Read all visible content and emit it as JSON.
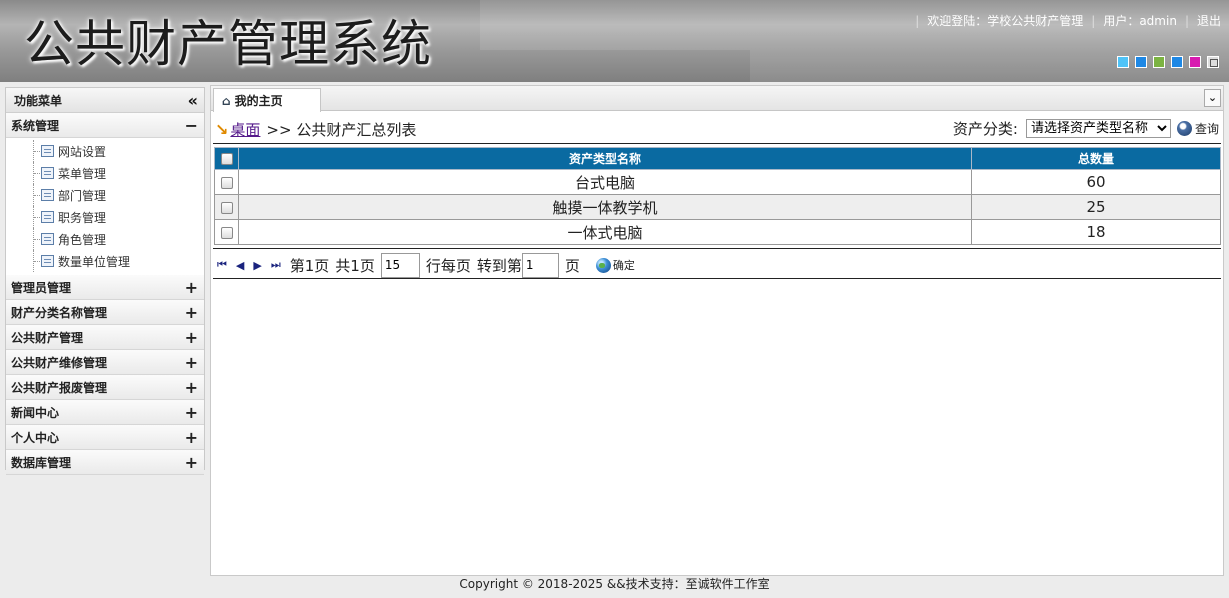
{
  "header": {
    "title": "公共财产管理系统",
    "welcome": "欢迎登陆：学校公共财产管理",
    "user_label": "用户：admin",
    "logout": "退出",
    "skin_colors": [
      "#4fc3f7",
      "#1e88e5",
      "#7cb342",
      "#1e88e5",
      "#d81bb0"
    ]
  },
  "sidebar": {
    "title": "功能菜单",
    "groups": [
      {
        "label": "系统管理",
        "expanded": true,
        "items": [
          "网站设置",
          "菜单管理",
          "部门管理",
          "职务管理",
          "角色管理",
          "数量单位管理"
        ]
      },
      {
        "label": "管理员管理"
      },
      {
        "label": "财产分类名称管理"
      },
      {
        "label": "公共财产管理"
      },
      {
        "label": "公共财产维修管理"
      },
      {
        "label": "公共财产报废管理"
      },
      {
        "label": "新闻中心"
      },
      {
        "label": "个人中心"
      },
      {
        "label": "数据库管理"
      }
    ]
  },
  "main": {
    "tab_label": "我的主页",
    "breadcrumb": {
      "link": "桌面",
      "rest": ">> 公共财产汇总列表"
    },
    "filter": {
      "label": "资产分类:",
      "select_value": "请选择资产类型名称",
      "query_label": "查询"
    },
    "table": {
      "headers": [
        "资产类型名称",
        "总数量"
      ],
      "rows": [
        {
          "name": "台式电脑",
          "count": "60"
        },
        {
          "name": "触摸一体教学机",
          "count": "25"
        },
        {
          "name": "一体式电脑",
          "count": "18"
        }
      ]
    },
    "pager": {
      "page_text": "第1页",
      "total_text": "共1页",
      "per_page_value": "15",
      "per_page_text": "行每页",
      "goto_text": "转到第",
      "goto_value": "1",
      "page_suffix": "页",
      "confirm_label": "确定"
    }
  },
  "footer": {
    "text": "Copyright © 2018-2025 &&技术支持：至诚软件工作室"
  }
}
